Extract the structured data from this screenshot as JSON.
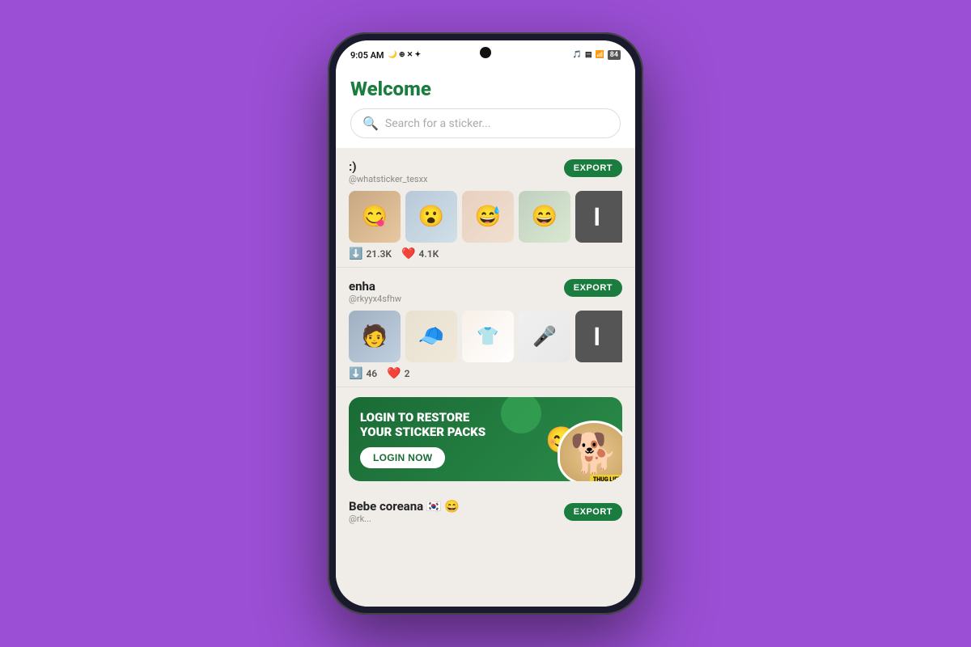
{
  "statusBar": {
    "time": "9:05 AM",
    "icons_left": "🌙 ⊕ ✕ ✦",
    "icons_right": "🎵 📊 📶 84"
  },
  "header": {
    "title": "Welcome",
    "search_placeholder": "Search for a sticker..."
  },
  "packs": [
    {
      "id": "pack1",
      "name": ":)",
      "author": "@whatsticker_tesxx",
      "export_label": "EXPORT",
      "downloads": "21.3K",
      "likes": "4.1K",
      "stickers": [
        "😋",
        "😮",
        "😅",
        "😄",
        "…"
      ]
    },
    {
      "id": "pack2",
      "name": "enha",
      "author": "@rkyyx4sfhw",
      "export_label": "EXPORT",
      "downloads": "46",
      "likes": "2",
      "stickers": [
        "🧑",
        "🧢",
        "👕",
        "🎤",
        "…"
      ]
    }
  ],
  "loginBanner": {
    "title": "LOGIN TO RESTORE\nYOUR STICKER PACKS",
    "button_label": "LOGIN NOW",
    "decoration": "🐕",
    "thug_label": "THUG LIFE"
  },
  "bottomPack": {
    "name": "Bebe coreana 🇰🇷 😄",
    "author": "@rk...",
    "export_label": "EXPORT"
  }
}
